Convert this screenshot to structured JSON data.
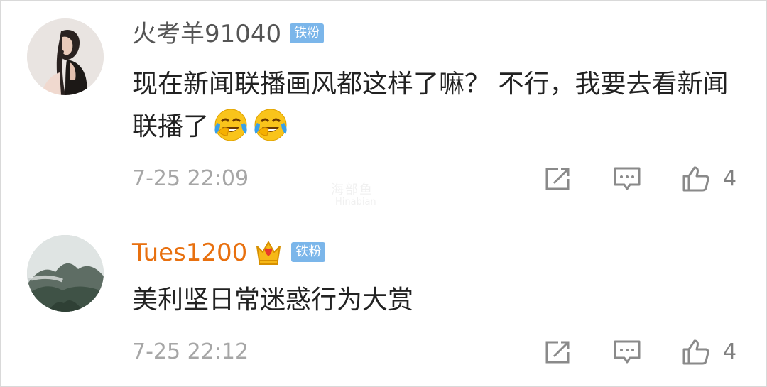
{
  "comments": [
    {
      "username": "火考羊91040",
      "badge": "铁粉",
      "text": "现在新闻联播画风都这样了嘛？ 不行，我要去看新闻联播了",
      "emoji_icons": [
        "laughing-crying-emoji",
        "laughing-crying-emoji"
      ],
      "timestamp": "7-25 22:09",
      "likes": "4"
    },
    {
      "username": "Tues1200",
      "crown_icon": "vip-crown-icon",
      "badge": "铁粉",
      "text": "美利坚日常迷惑行为大赏",
      "timestamp": "7-25 22:12",
      "likes": "4"
    }
  ],
  "watermark": {
    "main": "海部鱼",
    "sub": "Hinabian"
  },
  "colors": {
    "username_default": "#555555",
    "username_vip": "#e8700f",
    "badge_bg": "#7bb6ea",
    "meta": "#a6a6a6",
    "icon": "#8a8a8a"
  }
}
